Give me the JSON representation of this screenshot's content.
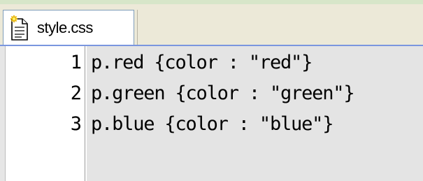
{
  "tab": {
    "label": "style.css",
    "icon": "new-document-icon"
  },
  "editor": {
    "lines": [
      {
        "number": "1",
        "text": "p.red {color : \"red\"}"
      },
      {
        "number": "2",
        "text": "p.green {color : \"green\"}"
      },
      {
        "number": "3",
        "text": "p.blue {color : \"blue\"}"
      }
    ]
  },
  "colors": {
    "tabbar_bg": "#ece9d8",
    "tab_border": "#7f9db9",
    "code_bg": "#e4e4e4",
    "text": "#000000"
  }
}
